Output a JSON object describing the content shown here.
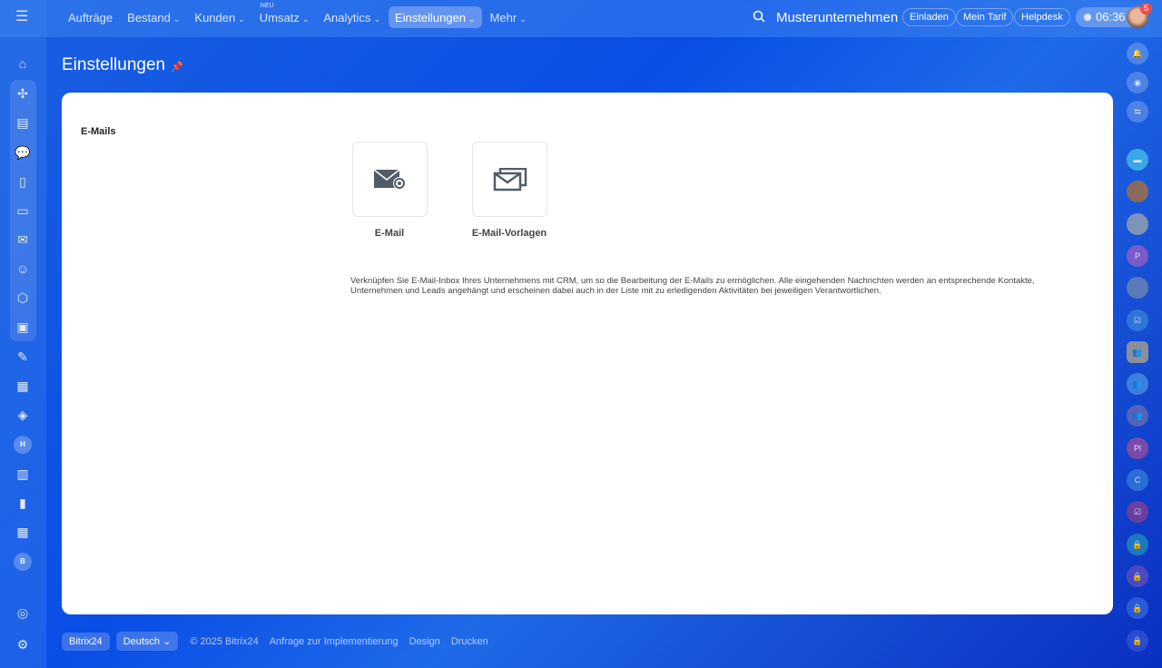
{
  "header": {
    "nav": [
      {
        "label": "Aufträge",
        "chevron": false
      },
      {
        "label": "Bestand",
        "chevron": true
      },
      {
        "label": "Kunden",
        "chevron": true
      },
      {
        "label": "Umsatz",
        "chevron": true,
        "tag": "NEU"
      },
      {
        "label": "Analytics",
        "chevron": true
      },
      {
        "label": "Einstellungen",
        "chevron": true,
        "active": true
      },
      {
        "label": "Mehr",
        "chevron": true
      }
    ],
    "company": "Musterunternehmen",
    "invite": "Einladen",
    "tariff": "Mein Tarif",
    "helpdesk": "Helpdesk",
    "time": "06:36",
    "notifications": "5"
  },
  "page": {
    "title": "Einstellungen"
  },
  "section": {
    "title": "E-Mails",
    "tiles": [
      {
        "label": "E-Mail",
        "icon": "email-settings-icon"
      },
      {
        "label": "E-Mail-Vorlagen",
        "icon": "email-templates-icon"
      }
    ],
    "description": "Verknüpfen Sie E-Mail-Inbox Ihres Unternehmens mit CRM, um so die Bearbeitung der E-Mails zu ermöglichen. Alle eingehenden Nachrichten werden an entsprechende Kontakte, Unternehmen und Leads angehängt und erscheinen dabei auch in der Liste mit zu erledigenden Aktivitäten bei jeweiligen Verantwortlichen."
  },
  "sidebar_left": {
    "h": "H",
    "b": "B"
  },
  "sidebar_right": {
    "p": "P",
    "pl": "Pl",
    "c": "C"
  },
  "footer": {
    "brand": "Bitrix24",
    "language": "Deutsch",
    "copyright": "© 2025 Bitrix24",
    "links": [
      "Anfrage zur Implementierung",
      "Design",
      "Drucken"
    ]
  }
}
